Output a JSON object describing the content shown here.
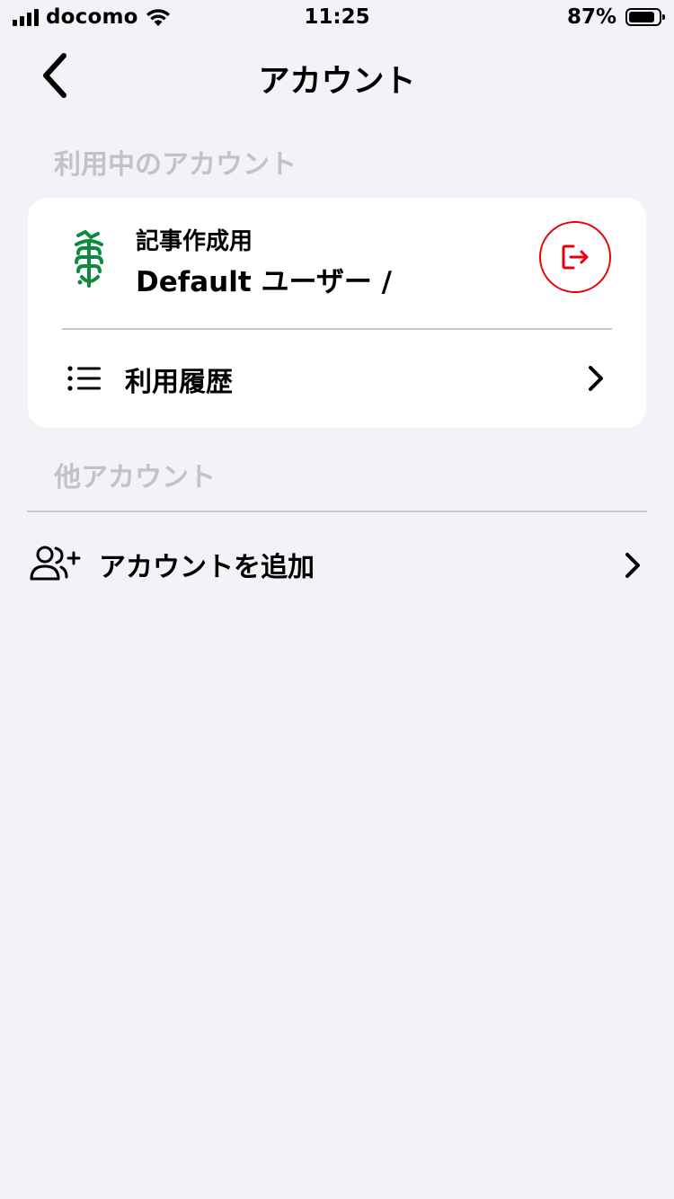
{
  "status_bar": {
    "carrier": "docomo",
    "time": "11:25",
    "battery_percent": "87%",
    "battery_level": 0.87
  },
  "nav": {
    "title": "アカウント",
    "back_icon": "chevron-left-icon"
  },
  "sections": {
    "current_label": "利用中のアカウント",
    "other_label": "他アカウント"
  },
  "current_account": {
    "subtitle": "記事作成用",
    "name": "Default ユーザー /",
    "logout_icon": "logout-icon",
    "logo_color": "#0e8a3e",
    "logout_color": "#e8000b"
  },
  "history": {
    "label": "利用履歴",
    "icon": "list-icon"
  },
  "add_account": {
    "label": "アカウントを追加",
    "icon": "add-user-icon"
  }
}
